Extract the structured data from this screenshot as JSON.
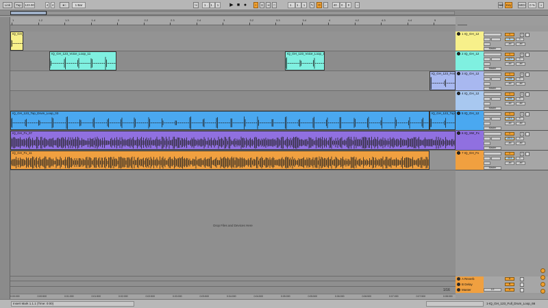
{
  "transport": {
    "link": "Link",
    "tap": "Tap",
    "tempo": "123.00",
    "sig_num": "4",
    "sig_den": "4",
    "metro": "●○",
    "quant": "1 Bar",
    "pos1": "1 .",
    "pos2": "1 .",
    "pos3": "1",
    "loop_start": "1 .",
    "loop_mid": "1 .",
    "loop_end": "1",
    "len1": "40 .",
    "len2": "0 .",
    "len3": "0",
    "key": "Key",
    "midi": "MIDI",
    "cpu": "0 %"
  },
  "ruler": {
    "labels": [
      "1",
      "1.2",
      "1.3",
      "1.4",
      "2",
      "2.2",
      "2.3",
      "2.4",
      "3",
      "3.2",
      "3.3",
      "3.4",
      "4",
      "4.2",
      "4.3",
      "4.4",
      "5"
    ],
    "set_label": "Set"
  },
  "tracks": [
    {
      "name": "1 IQ_GH_12",
      "color": "#f7f08a",
      "clips": [
        {
          "name": "IQ_GH_1",
          "color": "#f7f08a"
        }
      ],
      "vol": "0",
      "pan": "C",
      "route": "Master"
    },
    {
      "name": "2 IQ_GH_12",
      "color": "#7ff0e0",
      "clips": [
        {
          "name": "IQ_GH_123_Voice_Loop_11",
          "color": "#7ff0e0"
        },
        {
          "name": "IQ_GH_123_Voice_Loop_11",
          "color": "#7ff0e0"
        }
      ],
      "vol": "-4.7",
      "pan": "C",
      "route": "Master"
    },
    {
      "name": "3 IQ_GH_12",
      "color": "#a8b8f0",
      "clips": [
        {
          "name": "IQ_GH_123_Fem",
          "color": "#a8b8f0"
        }
      ],
      "vol": "-4.8",
      "pan": "C",
      "route": "Master"
    },
    {
      "name": "4 IQ_GH_12",
      "color": "#a8c8f0",
      "clips": [],
      "vol": "-6.6",
      "pan": "C",
      "route": "Master"
    },
    {
      "name": "5 IQ_GH_12",
      "color": "#4aa8f0",
      "clips": [
        {
          "name": "IQ_GH_123_Top_Drum_Loop_03",
          "color": "#4aa8f0"
        },
        {
          "name": "IQ_GH_123_Top",
          "color": "#4aa8f0"
        }
      ],
      "vol": "-3.1",
      "pan": "C",
      "route": "Master"
    },
    {
      "name": "6 IQ_SW_Fx",
      "color": "#9070e0",
      "clips": [
        {
          "name": "IQ_GH_Fx_07",
          "color": "#9070e0"
        }
      ],
      "vol": "-22.1",
      "pan": "C",
      "route": "Master"
    },
    {
      "name": "7 IQ_GH_Fx",
      "color": "#f0a040",
      "clips": [
        {
          "name": "IQ_GH_Fx_11",
          "color": "#f0a040"
        }
      ],
      "vol": "-5.4",
      "pan": "C",
      "route": "Master"
    }
  ],
  "track_io": {
    "inf": "-inf",
    "set": "S",
    "num": "1"
  },
  "returns": [
    {
      "name": "A Reverb",
      "color": "#f0a040",
      "letter": "A"
    },
    {
      "name": "B Delay",
      "color": "#f0a040",
      "letter": "B"
    },
    {
      "name": "Master",
      "color": "#f0a040",
      "letter": "0"
    }
  ],
  "master_extra": "1/2",
  "drop_text": "Drop Files and Devices Here",
  "zoom": "1/16",
  "time_labels": [
    "0:00:000",
    "0:00:500",
    "0:01:000",
    "0:01:500",
    "0:02:000",
    "0:02:500",
    "0:03:000",
    "0:03:500",
    "0:04:000",
    "0:04:500",
    "0:05:000",
    "0:05:500",
    "0:06:000",
    "0:06:500",
    "0:07:000",
    "0:07:500",
    "0:08:000"
  ],
  "status": {
    "message": "Insert Mark 1.1.1 (Time: 0:00)",
    "right": "1-IQ_GH_123_Full_Drum_Loop_66"
  }
}
